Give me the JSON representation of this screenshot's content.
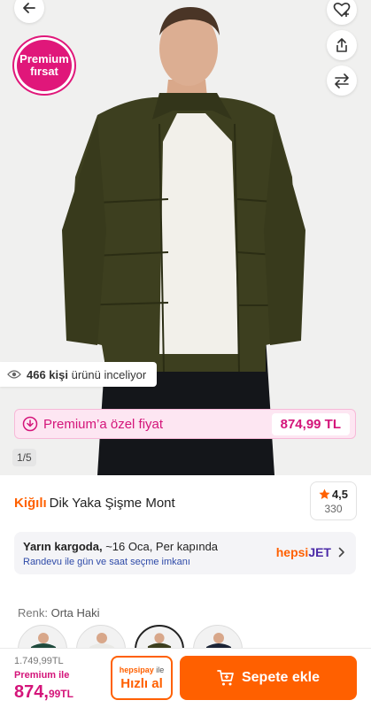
{
  "hero": {
    "premium_badge_line1": "Premium",
    "premium_badge_line2": "fırsat",
    "viewers_count": "466 kişi",
    "viewers_text": "ürünü inceliyor",
    "premium_price_label": "Premium’a özel fiyat",
    "premium_price_value": "874,99 TL",
    "pager": "1/5"
  },
  "product": {
    "brand": "Kiğılı",
    "name": "Dik Yaka Şişme Mont",
    "rating": "4,5",
    "rating_count": "330"
  },
  "delivery": {
    "when": "Yarın kargoda,",
    "detail": " ~16 Oca, Per kapında",
    "note": "Randevu ile gün ve saat seçme imkanı",
    "carrier_part1": "hepsi",
    "carrier_part2": "JET"
  },
  "color": {
    "label": "Renk:",
    "value": "Orta Haki"
  },
  "bottom": {
    "old_price": "1.749,99TL",
    "premium_with": "Premium ile",
    "final_price_main": "874,",
    "final_price_small": "99TL",
    "quick_pay_brand": "hepsipay",
    "quick_pay_suffix": " ile",
    "quick_buy_label": "Hızlı al",
    "add_to_cart_label": "Sepete ekle"
  },
  "icons": {
    "back": "arrow-left-icon",
    "favorite": "heart-plus-icon",
    "share": "share-icon",
    "compare": "compare-arrows-icon",
    "eye": "eye-icon",
    "premium": "premium-tag-icon",
    "star": "star-icon",
    "chevron": "chevron-right-icon",
    "cart": "cart-plus-icon"
  },
  "colors": {
    "accent": "#ff6000",
    "premium": "#d4157a",
    "jacket": "#3d3f1f"
  }
}
